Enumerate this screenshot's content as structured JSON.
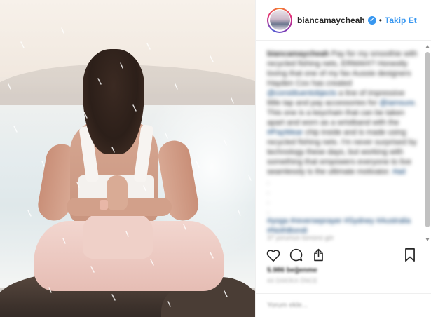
{
  "post": {
    "username": "biancamaycheah",
    "verified_glyph": "✔",
    "separator": "•",
    "follow_label": "Takip Et"
  },
  "caption": {
    "username": "biancamaycheah",
    "text_1": "Pay for my smoothie with recycled fishing nets, ERMAH!? Honestly loving that one of my fav Aussie designers Hayden Cox has created",
    "mention_1": "@constituentobjects",
    "text_2": "a line of impressive little tap and pay accessories for",
    "mention_2": "@iamsure",
    "text_3": ". This one is a keychain that can be taken apart and worn as a wristband with the",
    "tag_1": "#PayWear",
    "text_4": "chip inside and is made using recycled fishing nets. I'm never surprised by technology these days, but working with something that empowers everyone to live seamlessly is the ultimate motivator.",
    "tag_2": "#ad",
    "hashtags": "#yoga #reverseprayer #Sydney #Australia #NothBondi",
    "timestamp": "37 yorumun tümünü gör"
  },
  "actions": {
    "like_icon": "heart-icon",
    "comment_icon": "comment-icon",
    "share_icon": "share-icon",
    "save_icon": "bookmark-icon"
  },
  "likes_text": "5.986 beğenme",
  "date_text": "44 DAKİKA ÖNCE",
  "comment_placeholder": "Yorum ekle...",
  "colors": {
    "accent": "#3897f0",
    "text": "#262626",
    "muted": "#999999",
    "divider": "#efefef"
  }
}
